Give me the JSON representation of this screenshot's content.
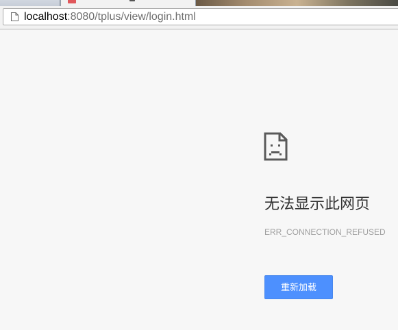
{
  "address_bar": {
    "url_host": "localhost",
    "url_rest": ":8080/tplus/view/login.html"
  },
  "error": {
    "icon": "sad-document-icon",
    "title": "无法显示此网页",
    "code": "ERR_CONNECTION_REFUSED",
    "reload_label": "重新加载"
  },
  "colors": {
    "page_background": "#f7f7f7",
    "button_blue": "#4d90fe",
    "error_code_gray": "#a0a0a0",
    "title_text": "#333333"
  }
}
